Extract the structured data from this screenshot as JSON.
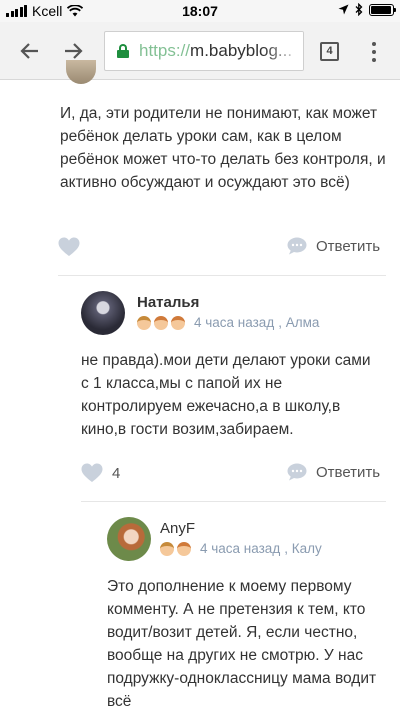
{
  "status_bar": {
    "carrier": "Kcell",
    "time": "18:07"
  },
  "browser": {
    "url_scheme": "https://",
    "url_host": "m.babyblog...",
    "tab_count": "4"
  },
  "comments": [
    {
      "text": "И, да, эти родители не понимают, как может ребёнок делать уроки сам, как в целом ребёнок может что-то делать без контроля, и активно обсуждают и осуждают это всё)",
      "likes": "",
      "reply_label": "Ответить"
    },
    {
      "author": "Наталья",
      "time_ago": "4 часа назад",
      "location": ", Алма",
      "kids": [
        "boy",
        "girl",
        "girl"
      ],
      "text": "не правда).мои дети делают уроки сами с 1 класса,мы с папой их не контролируем ежечасно,а в школу,в кино,в гости возим,забираем.",
      "likes": "4",
      "reply_label": "Ответить"
    },
    {
      "author": "AnyF",
      "time_ago": "4 часа назад",
      "location": ", Калу",
      "kids": [
        "boy",
        "girl"
      ],
      "text": "Это дополнение к моему первому комменту. А не претензия к тем, кто водит/возит детей. Я, если честно, вообще на других не смотрю. У нас подружку-одноклассницу мама водит всё"
    }
  ],
  "colors": {
    "secure_green": "#1e8e3e",
    "meta_blue": "#8a9bb0",
    "icon_gray": "#c9d1dc"
  }
}
